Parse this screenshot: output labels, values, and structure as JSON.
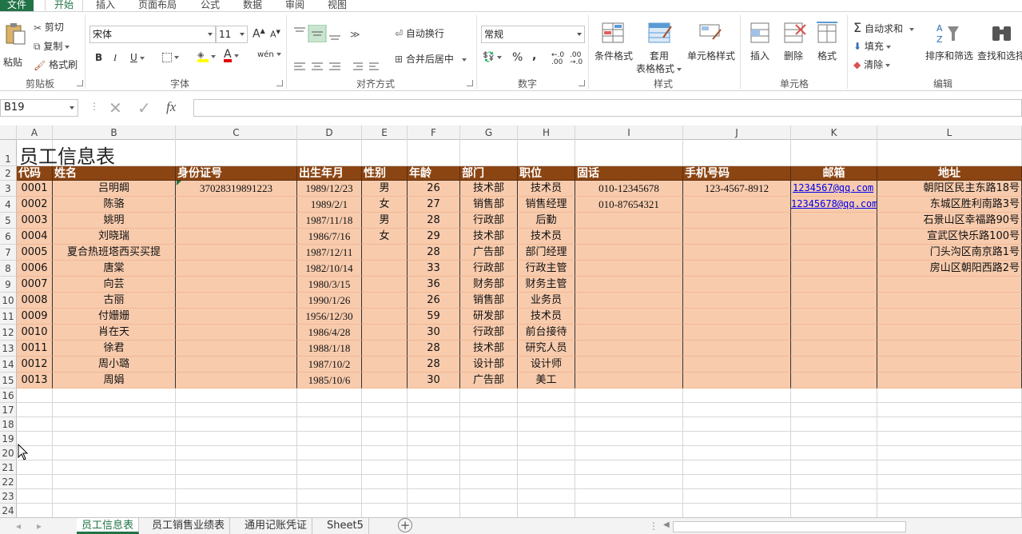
{
  "ribbon_tabs": [
    "文件",
    "开始",
    "插入",
    "页面布局",
    "公式",
    "数据",
    "审阅",
    "视图"
  ],
  "clipboard": {
    "paste": "粘贴",
    "cut": "剪切",
    "copy": "复制",
    "format_painter": "格式刷",
    "label": "剪贴板"
  },
  "font": {
    "name": "宋体",
    "size": "11",
    "label": "字体",
    "bold": "B",
    "italic": "I",
    "underline": "U",
    "phonetic": "wén"
  },
  "alignment": {
    "wrap": "自动换行",
    "merge": "合并后居中",
    "label": "对齐方式"
  },
  "number": {
    "format": "常规",
    "percent": "%",
    "comma": ",",
    "label": "数字"
  },
  "styles": {
    "conditional": "条件格式",
    "table_fmt_1": "套用",
    "table_fmt_2": "表格格式",
    "cell_styles": "单元格样式",
    "label": "样式"
  },
  "cells": {
    "insert": "插入",
    "delete": "删除",
    "format": "格式",
    "label": "单元格"
  },
  "editing": {
    "autosum": "自动求和",
    "fill": "填充",
    "clear": "清除",
    "sort": "排序和筛选",
    "find": "查找和选择",
    "label": "编辑"
  },
  "formula_bar": {
    "name_box": "B19",
    "fx": "fx",
    "content": ""
  },
  "columns": [
    "A",
    "B",
    "C",
    "D",
    "E",
    "F",
    "G",
    "H",
    "I",
    "J",
    "K",
    "L"
  ],
  "rows": [
    "1",
    "2",
    "3",
    "4",
    "5",
    "6",
    "7",
    "8",
    "9",
    "10",
    "11",
    "12",
    "13",
    "14",
    "15",
    "16",
    "17",
    "18",
    "19",
    "20",
    "21",
    "22",
    "23",
    "24"
  ],
  "sheet": {
    "title": "员工信息表",
    "headers": [
      "代码",
      "姓名",
      "身份证号",
      "出生年月",
      "性别",
      "年龄",
      "部门",
      "职位",
      "固话",
      "手机号码",
      "邮箱",
      "地址"
    ],
    "records": [
      [
        "0001",
        "吕明皗",
        "37028319891223",
        "1989/12/23",
        "男",
        "26",
        "技术部",
        "技术员",
        "010-12345678",
        "123-4567-8912",
        "1234567@qq.com",
        "朝阳区民主东路18号"
      ],
      [
        "0002",
        "陈骆",
        "",
        "1989/2/1",
        "女",
        "27",
        "销售部",
        "销售经理",
        "010-87654321",
        "",
        "12345678@qq.com",
        "东城区胜利南路3号"
      ],
      [
        "0003",
        "姚明",
        "",
        "1987/11/18",
        "男",
        "28",
        "行政部",
        "后勤",
        "",
        "",
        "",
        "石景山区幸福路90号"
      ],
      [
        "0004",
        "刘晓瑞",
        "",
        "1986/7/16",
        "女",
        "29",
        "技术部",
        "技术员",
        "",
        "",
        "",
        "宣武区快乐路100号"
      ],
      [
        "0005",
        "夏合热班塔西买买提",
        "",
        "1987/12/11",
        "",
        "28",
        "广告部",
        "部门经理",
        "",
        "",
        "",
        "门头沟区南京路1号"
      ],
      [
        "0006",
        "唐棠",
        "",
        "1982/10/14",
        "",
        "33",
        "行政部",
        "行政主管",
        "",
        "",
        "",
        "房山区朝阳西路2号"
      ],
      [
        "0007",
        "向芸",
        "",
        "1980/3/15",
        "",
        "36",
        "财务部",
        "财务主管",
        "",
        "",
        "",
        ""
      ],
      [
        "0008",
        "古丽",
        "",
        "1990/1/26",
        "",
        "26",
        "销售部",
        "业务员",
        "",
        "",
        "",
        ""
      ],
      [
        "0009",
        "付姗姗",
        "",
        "1956/12/30",
        "",
        "59",
        "研发部",
        "技术员",
        "",
        "",
        "",
        ""
      ],
      [
        "0010",
        "肖在天",
        "",
        "1986/4/28",
        "",
        "30",
        "行政部",
        "前台接待",
        "",
        "",
        "",
        ""
      ],
      [
        "0011",
        "徐君",
        "",
        "1988/1/18",
        "",
        "28",
        "技术部",
        "研究人员",
        "",
        "",
        "",
        ""
      ],
      [
        "0012",
        "周小璐",
        "",
        "1987/10/2",
        "",
        "28",
        "设计部",
        "设计师",
        "",
        "",
        "",
        ""
      ],
      [
        "0013",
        "周娟",
        "",
        "1985/10/6",
        "",
        "30",
        "广告部",
        "美工",
        "",
        "",
        "",
        ""
      ]
    ]
  },
  "sheet_tabs": [
    "员工信息表",
    "员工销售业绩表",
    "通用记账凭证",
    "Sheet5"
  ],
  "active_sheet": "员工信息表",
  "colors": {
    "accent": "#217346",
    "header_bg": "#8b4513",
    "body_bg": "#f8cbad"
  }
}
